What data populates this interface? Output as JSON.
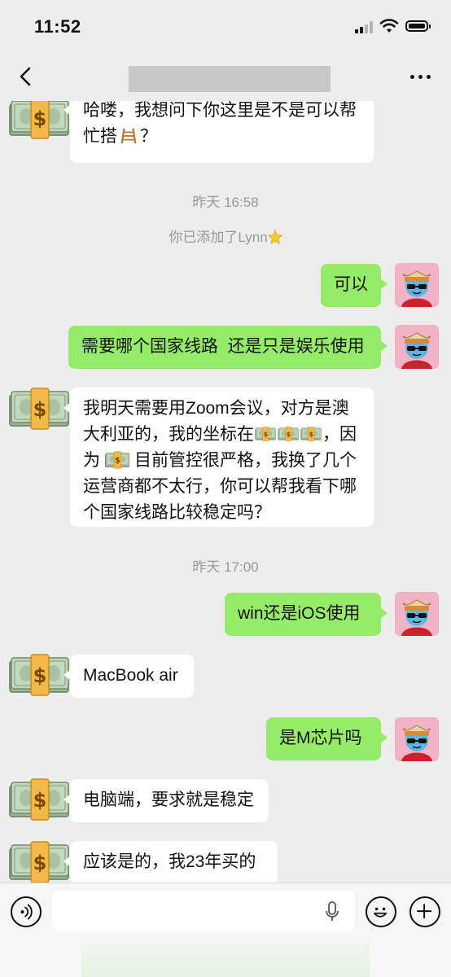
{
  "status_bar": {
    "time": "11:52"
  },
  "nav": {
    "title": ""
  },
  "messages": [
    {
      "side": "left",
      "text": "哈喽，我想问下你这里是不是可以帮忙搭🪜？"
    },
    {
      "type": "timestamp",
      "text": "昨天 16:58"
    },
    {
      "type": "system",
      "text": "你已添加了Lynn🌟"
    },
    {
      "side": "right",
      "text": "可以"
    },
    {
      "side": "right",
      "text": "需要哪个国家线路  还是只是娱乐使用"
    },
    {
      "side": "left",
      "text": "我明天需要用Zoom会议，对方是澳大利亚的，我的坐标在💵💵💵，因为💵目前管控很严格，我换了几个运营商都不太行，你可以帮我看下哪个国家线路比较稳定吗？"
    },
    {
      "type": "timestamp",
      "text": "昨天 17:00"
    },
    {
      "side": "right",
      "text": "win还是iOS使用"
    },
    {
      "side": "left",
      "text": "MacBook air"
    },
    {
      "side": "right",
      "text": "是M芯片吗"
    },
    {
      "side": "left",
      "text": "电脑端，要求就是稳定"
    },
    {
      "side": "left",
      "text": "应该是的，我23年买的"
    }
  ],
  "msg_parts": {
    "m0_line1": "哈喽，我想问下你这里是不是可以帮",
    "m0_line2a": "忙搭",
    "m0_line2b": "？",
    "m2_prefix": "你已添加了Lynn",
    "m5_line1": "我明天需要用Zoom会议，对方是澳",
    "m5_line2a": "大利亚的，我的坐标在",
    "m5_line2b": "，因",
    "m5_line3a": "为",
    "m5_line3b": "目前管控很严格，我换了几个",
    "m5_line4": "运营商都不太行，你可以帮我看下哪",
    "m5_line5": "个国家线路比较稳定吗？"
  },
  "input": {
    "placeholder": ""
  },
  "icons": {
    "back": "chevron-left-icon",
    "more": "more-dots-icon",
    "voice": "voice-icon",
    "mic": "mic-icon",
    "emoji": "emoji-icon",
    "plus": "plus-icon"
  },
  "colors": {
    "background": "#ededed",
    "bubble_self": "#95ec69",
    "bubble_other": "#ffffff",
    "timestamp": "#999999"
  }
}
